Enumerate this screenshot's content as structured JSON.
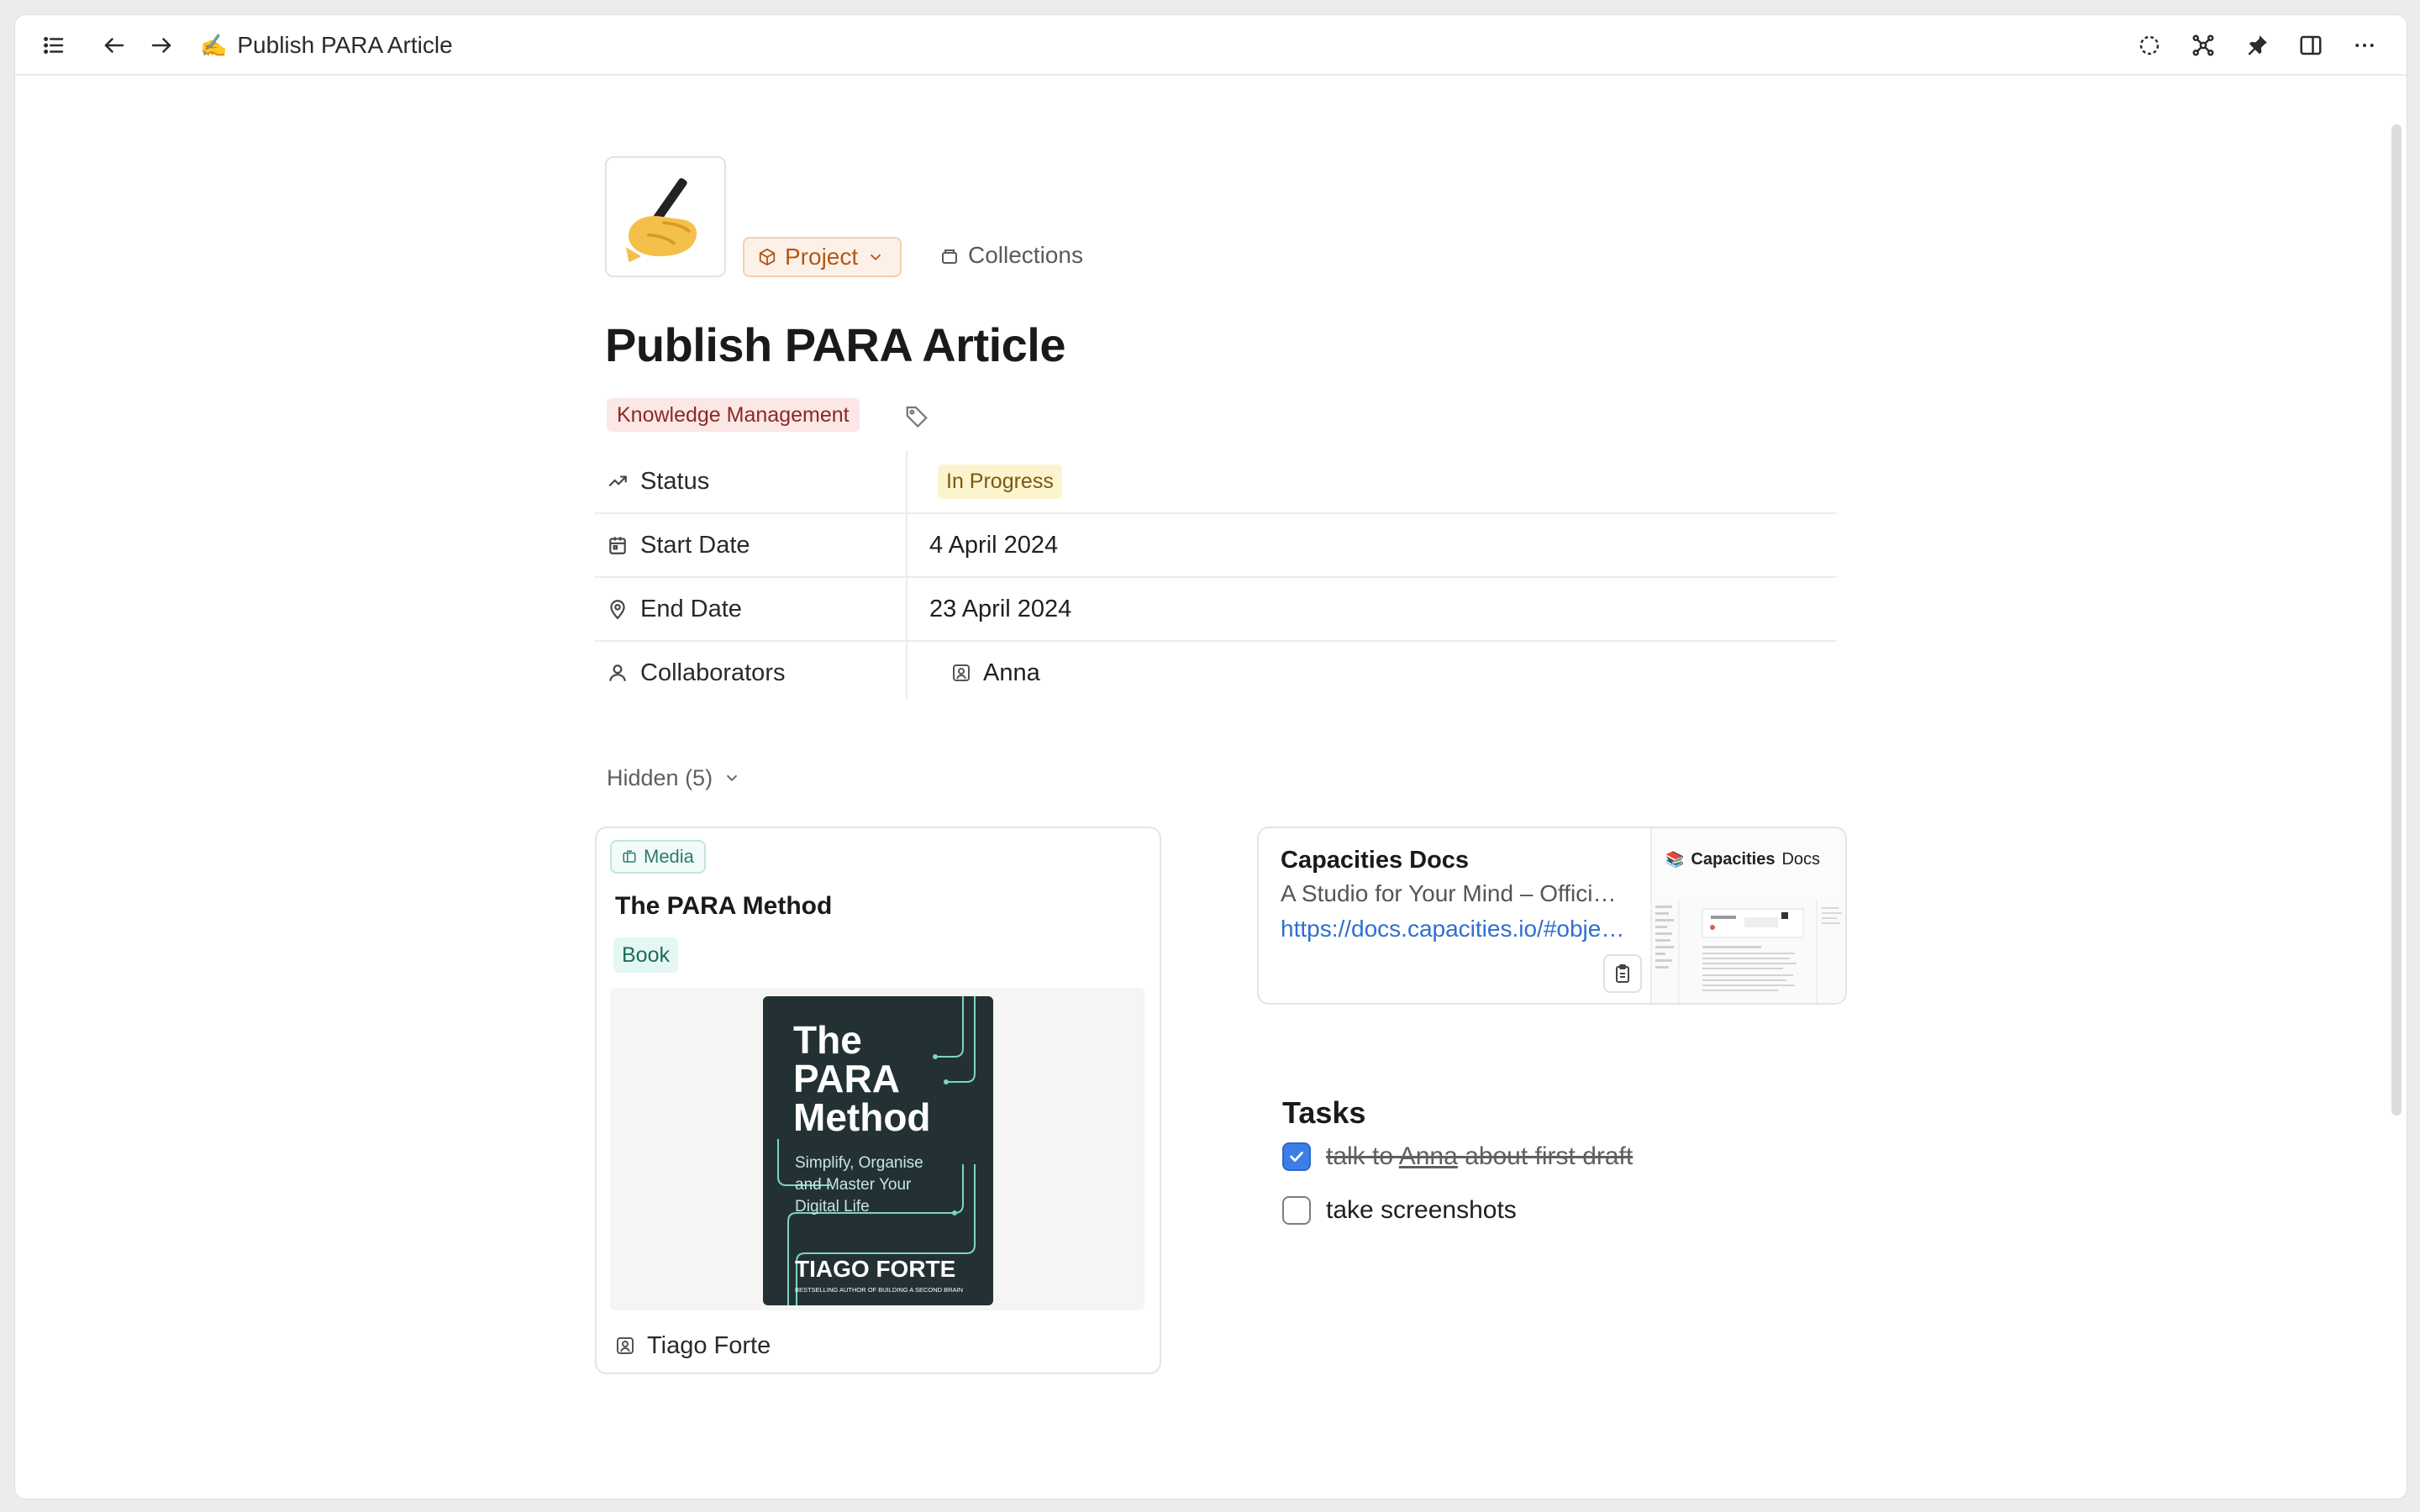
{
  "topbar": {
    "page_emoji": "✍️",
    "breadcrumb": "Publish PARA Article",
    "icons": [
      "sidebar-list-icon",
      "arrow-left-icon",
      "arrow-right-icon",
      "dashed-circle-icon",
      "graph-icon",
      "pin-icon",
      "split-view-icon",
      "more-icon"
    ]
  },
  "header": {
    "type_label": "Project",
    "collections_label": "Collections",
    "title": "Publish PARA Article",
    "tag": "Knowledge Management"
  },
  "properties": [
    {
      "label": "Status",
      "value": "In Progress",
      "icon": "trend-icon"
    },
    {
      "label": "Start Date",
      "value": "4 April 2024",
      "icon": "calendar-icon"
    },
    {
      "label": "End Date",
      "value": "23 April 2024",
      "icon": "location-pin-icon"
    },
    {
      "label": "Collaborators",
      "value": "Anna",
      "icon": "person-icon"
    }
  ],
  "hidden": {
    "label": "Hidden (5)"
  },
  "media_card": {
    "badge": "Media",
    "title": "The PARA Method",
    "tag": "Book",
    "cover": {
      "line1": "The",
      "line2": "PARA",
      "line3": "Method",
      "subtitle1": "Simplify, Organise",
      "subtitle2": "and Master Your",
      "subtitle3": "Digital Life",
      "author": "TIAGO FORTE",
      "tagline": "BESTSELLING AUTHOR OF BUILDING A SECOND BRAIN"
    },
    "author": "Tiago Forte"
  },
  "link_card": {
    "title": "Capacities Docs",
    "description": "A Studio for Your Mind – Official documentation",
    "url": "https://docs.capacities.io/#object-types",
    "thumb_title_a": "Capacities",
    "thumb_title_b": "Docs"
  },
  "tasks": {
    "heading": "Tasks",
    "items": [
      {
        "before": "talk to ",
        "mention": "Anna",
        "after": " about first draft",
        "done": true
      },
      {
        "text": "take screenshots",
        "done": false
      }
    ]
  },
  "colors": {
    "accent_blue": "#3d7ee6",
    "project_orange": "#b4561a",
    "status_yellow": "#fcf3cf",
    "tag_red": "#fbe7e6",
    "media_teal": "#2a7c6e"
  }
}
